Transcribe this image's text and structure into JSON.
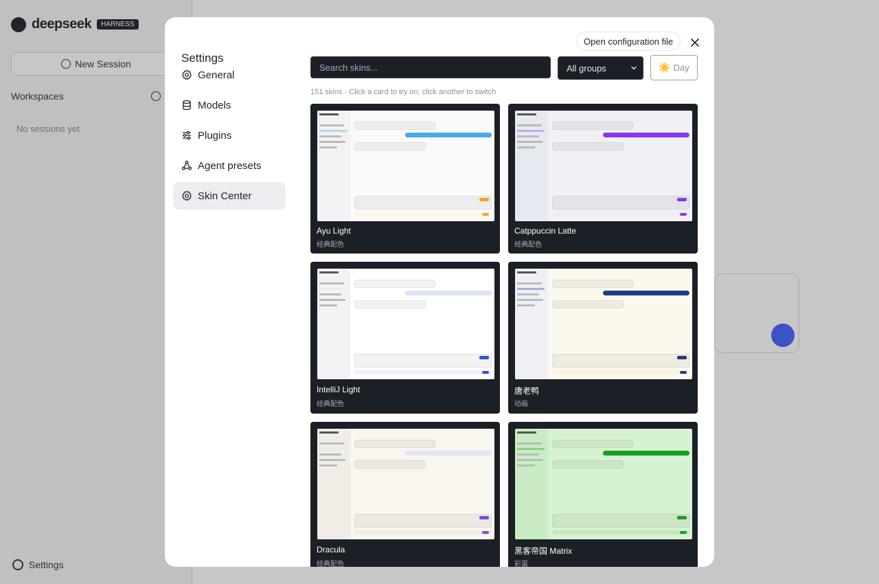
{
  "background": {
    "brand": "deepseek",
    "brand_badge": "HARNESS",
    "new_session_label": "New Session",
    "workspaces_label": "Workspaces",
    "no_sessions": "No sessions yet",
    "settings_label": "Settings"
  },
  "modal": {
    "title": "Settings",
    "open_config_label": "Open configuration file",
    "nav": [
      {
        "label": "General",
        "icon": "gear-icon"
      },
      {
        "label": "Models",
        "icon": "database-icon"
      },
      {
        "label": "Plugins",
        "icon": "sliders-icon"
      },
      {
        "label": "Agent presets",
        "icon": "nodes-icon"
      },
      {
        "label": "Skin Center",
        "icon": "gear-icon",
        "active": true
      }
    ],
    "skins": {
      "search_placeholder": "Search skins...",
      "group_selected": "All groups",
      "mode_icon": "☀️",
      "mode_label": "Day",
      "hint": "151 skins · Click a card to try on; click another to switch",
      "cards": [
        {
          "name": "Ayu Light",
          "group": "经典配色",
          "accent": "#4aa8e8",
          "bg": "#fafafa",
          "side": "#f2f2f2",
          "bar": "#fff5e6",
          "btn": "#f5a623"
        },
        {
          "name": "Catppuccin Latte",
          "group": "经典配色",
          "accent": "#8839ef",
          "bg": "#eff1f5",
          "side": "#e6e9ef",
          "bar": "#f1ecf8",
          "btn": "#8839ef"
        },
        {
          "name": "IntelliJ Light",
          "group": "经典配色",
          "accent": "#dbe4f8",
          "bg": "#ffffff",
          "side": "#f2f2f2",
          "bar": "#eef2fb",
          "btn": "#2f56c9"
        },
        {
          "name": "唐老鸭",
          "group": "动画",
          "accent": "#1e3a8a",
          "bg": "#fbf8ee",
          "side": "#eef0f6",
          "bar": "#fdf3dc",
          "btn": "#1e3a8a"
        },
        {
          "name": "Dracula",
          "group": "经典配色",
          "accent": "#e7e2f6",
          "bg": "#f8f6ef",
          "side": "#efede6",
          "bar": "#efece4",
          "btn": "#7c4dd6"
        },
        {
          "name": "黑客帝国 Matrix",
          "group": "彩蛋",
          "accent": "#14a01e",
          "bg": "#d7f2d2",
          "side": "#c9ecc4",
          "bar": "#c3e9be",
          "btn": "#14a01e"
        }
      ]
    }
  }
}
